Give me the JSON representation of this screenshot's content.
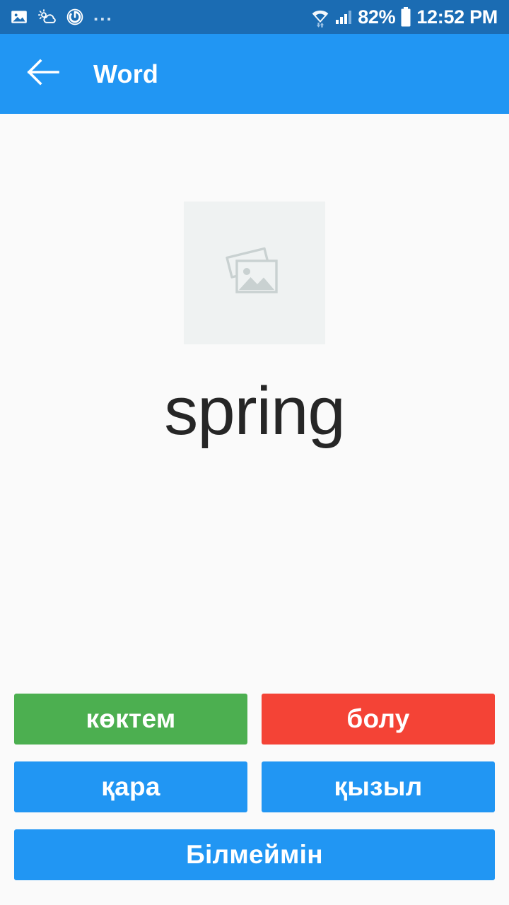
{
  "status_bar": {
    "background_color": "#1b6cb3",
    "left_icons": [
      {
        "name": "gallery-icon",
        "label": "image"
      },
      {
        "name": "weather-icon",
        "label": "weather"
      },
      {
        "name": "power-timer-icon",
        "label": "power"
      },
      {
        "name": "more-icons-ellipsis",
        "label": "..."
      }
    ],
    "wifi_icon": "wifi-icon",
    "signal_icon": "cellular-signal-icon",
    "battery_percent": "82%",
    "battery_icon": "battery-icon",
    "clock": "12:52 PM"
  },
  "toolbar": {
    "background_color": "#2196f3",
    "back_icon": "back-arrow-icon",
    "title": "Word"
  },
  "main": {
    "background_color": "#fafafa",
    "image_placeholder": {
      "icon": "image-placeholder-icon",
      "background_color": "#eff2f2"
    },
    "word": "spring"
  },
  "answers": {
    "options": [
      {
        "label": "көктем",
        "color": "#4caf50",
        "state": "correct",
        "width": "half"
      },
      {
        "label": "болу",
        "color": "#f44336",
        "state": "wrong",
        "width": "half"
      },
      {
        "label": "қара",
        "color": "#2196f3",
        "state": "default",
        "width": "half"
      },
      {
        "label": "қызыл",
        "color": "#2196f3",
        "state": "default",
        "width": "half"
      },
      {
        "label": "Білмеймін",
        "color": "#2196f3",
        "state": "default",
        "width": "full"
      }
    ]
  }
}
